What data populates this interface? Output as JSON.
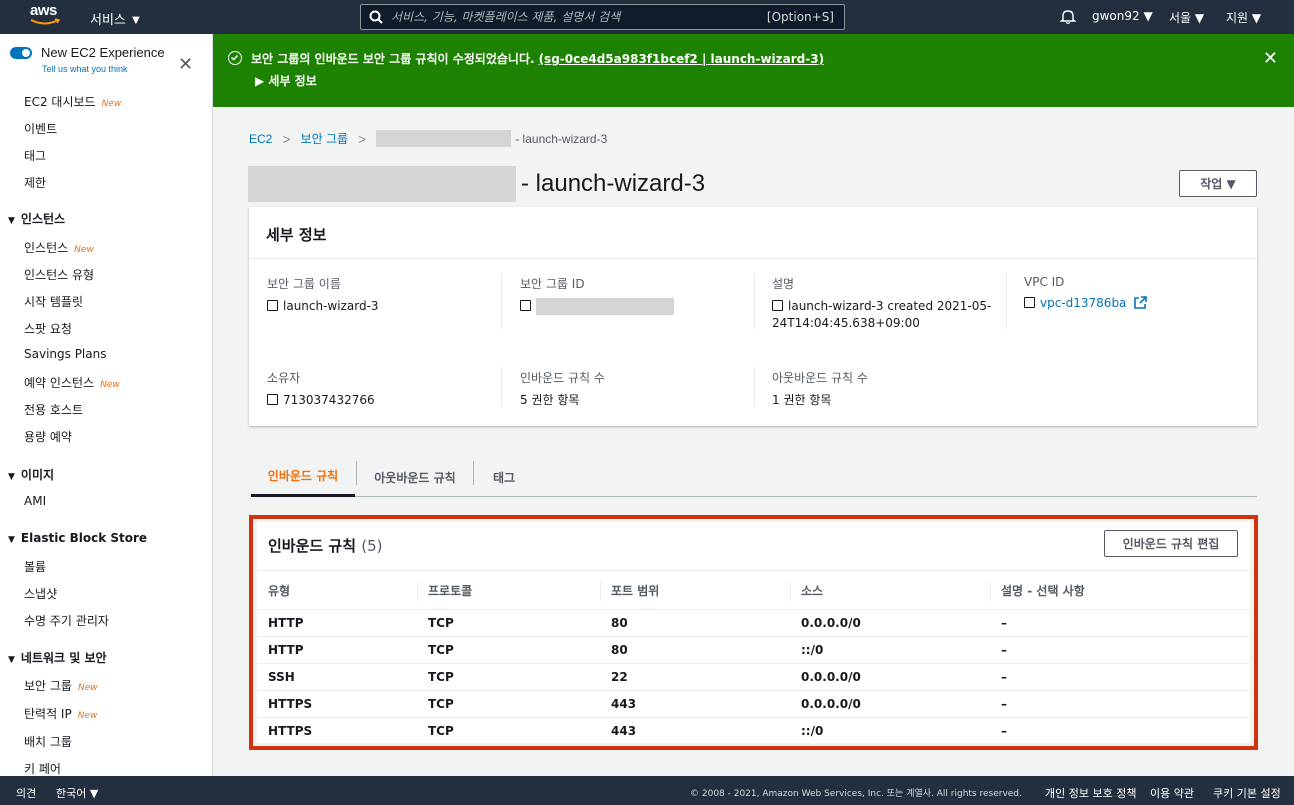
{
  "topnav": {
    "logo": "aws",
    "services": "서비스 ▼",
    "search_placeholder": "서비스, 기능, 마켓플레이스 제품, 설명서 검색",
    "search_shortcut": "[Option+S]",
    "user": "gwon92 ▼",
    "region": "서울 ▼",
    "support": "지원 ▼"
  },
  "sidebar": {
    "toggle_title": "New EC2 Experience",
    "toggle_link": "Tell us what you think",
    "new_badge": "New",
    "items": [
      {
        "label": "EC2 대시보드",
        "new": true
      },
      {
        "label": "이벤트"
      },
      {
        "label": "태그"
      },
      {
        "label": "제한"
      }
    ],
    "sections": [
      {
        "title": "인스턴스",
        "items": [
          {
            "label": "인스턴스",
            "new": true
          },
          {
            "label": "인스턴스 유형"
          },
          {
            "label": "시작 템플릿"
          },
          {
            "label": "스팟 요청"
          },
          {
            "label": "Savings Plans"
          },
          {
            "label": "예약 인스턴스",
            "new": true
          },
          {
            "label": "전용 호스트"
          },
          {
            "label": "용량 예약"
          }
        ]
      },
      {
        "title": "이미지",
        "items": [
          {
            "label": "AMI"
          }
        ]
      },
      {
        "title": "Elastic Block Store",
        "items": [
          {
            "label": "볼륨"
          },
          {
            "label": "스냅샷"
          },
          {
            "label": "수명 주기 관리자"
          }
        ]
      },
      {
        "title": "네트워크 및 보안",
        "items": [
          {
            "label": "보안 그룹",
            "new": true
          },
          {
            "label": "탄력적 IP",
            "new": true
          },
          {
            "label": "배치 그룹"
          },
          {
            "label": "키 페어"
          }
        ]
      }
    ]
  },
  "flash": {
    "message": "보안 그룹의 인바운드 보안 그룹 규칙이 수정되었습니다.",
    "link": "(sg-0ce4d5a983f1bcef2 | launch-wizard-3)",
    "details": "▶ 세부 정보"
  },
  "breadcrumb": {
    "ec2": "EC2",
    "security_groups": "보안 그룹",
    "current": "- launch-wizard-3"
  },
  "page": {
    "title": "- launch-wizard-3",
    "actions": "작업 ▼"
  },
  "details": {
    "heading": "세부 정보",
    "sg_name_label": "보안 그룹 이름",
    "sg_name": "launch-wizard-3",
    "sg_id_label": "보안 그룹 ID",
    "desc_label": "설명",
    "desc_line1": "launch-wizard-3 created 2021-05-",
    "desc_line2": "24T14:04:45.638+09:00",
    "vpc_label": "VPC ID",
    "vpc": "vpc-d13786ba",
    "owner_label": "소유자",
    "owner": "713037432766",
    "inbound_count_label": "인바운드 규칙 수",
    "inbound_count": "5 권한 항목",
    "outbound_count_label": "아웃바운드 규칙 수",
    "outbound_count": "1 권한 항목"
  },
  "tabs": [
    "인바운드 규칙",
    "아웃바운드 규칙",
    "태그"
  ],
  "inbound": {
    "heading": "인바운드 규칙",
    "count": "(5)",
    "edit": "인바운드 규칙 편집",
    "columns": [
      "유형",
      "프로토콜",
      "포트 범위",
      "소스",
      "설명 - 선택 사항"
    ],
    "rows": [
      [
        "HTTP",
        "TCP",
        "80",
        "0.0.0.0/0",
        "–"
      ],
      [
        "HTTP",
        "TCP",
        "80",
        "::/0",
        "–"
      ],
      [
        "SSH",
        "TCP",
        "22",
        "0.0.0.0/0",
        "–"
      ],
      [
        "HTTPS",
        "TCP",
        "443",
        "0.0.0.0/0",
        "–"
      ],
      [
        "HTTPS",
        "TCP",
        "443",
        "::/0",
        "–"
      ]
    ]
  },
  "footer": {
    "feedback": "의견",
    "language": "한국어 ▼",
    "copyright": "© 2008 - 2021, Amazon Web Services, Inc. 또는 계열사. All rights reserved.",
    "privacy": "개인 정보 보호 정책",
    "terms": "이용 약관",
    "cookies": "쿠키 기본 설정"
  },
  "colors": {
    "nav": "#232f3e",
    "flash_success": "#1d8102",
    "link": "#0073bb",
    "accent": "#ec7211",
    "highlight": "#d13212"
  }
}
